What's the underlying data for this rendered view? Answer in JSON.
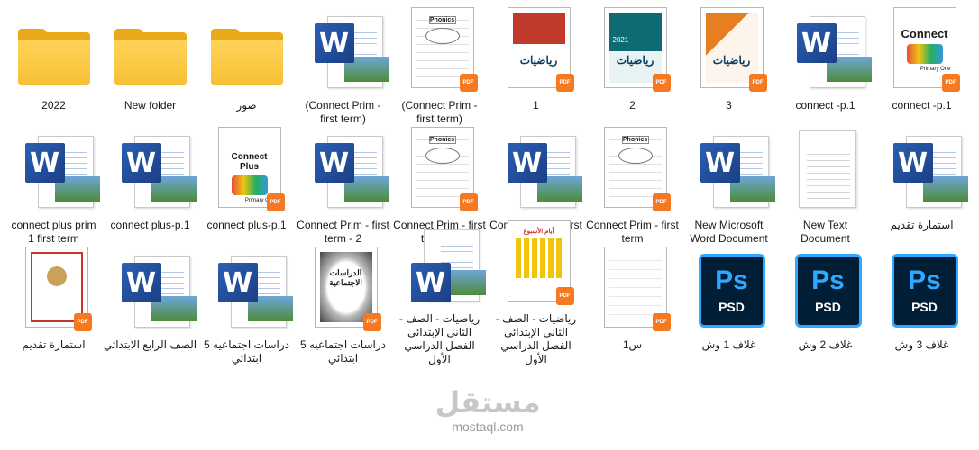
{
  "files": [
    {
      "name": "2022",
      "type": "folder",
      "rtl": false
    },
    {
      "name": "New folder",
      "type": "folder",
      "rtl": false
    },
    {
      "name": "صور",
      "type": "folder",
      "rtl": false
    },
    {
      "name": "(Connect Prim - first term)",
      "type": "word",
      "rtl": false
    },
    {
      "name": "(Connect Prim - first term)",
      "type": "pdf",
      "art": "worksheet",
      "rtl": false
    },
    {
      "name": "1",
      "type": "pdf",
      "art": "math-red",
      "rtl": false
    },
    {
      "name": "2",
      "type": "pdf",
      "art": "math-teal",
      "rtl": false
    },
    {
      "name": "3",
      "type": "pdf",
      "art": "math-orange",
      "rtl": false
    },
    {
      "name": "connect -p.1",
      "type": "word",
      "rtl": false
    },
    {
      "name": "connect -p.1",
      "type": "pdf",
      "art": "connect",
      "rtl": false
    },
    {
      "name": "connect plus prim 1 first term",
      "type": "word",
      "rtl": false
    },
    {
      "name": "connect plus-p.1",
      "type": "word",
      "rtl": false
    },
    {
      "name": "connect plus-p.1",
      "type": "pdf",
      "art": "connect-plus",
      "rtl": false
    },
    {
      "name": "Connect Prim - first term - 2",
      "type": "word",
      "rtl": false
    },
    {
      "name": "Connect Prim - first term - 2",
      "type": "pdf",
      "art": "phonics",
      "rtl": false
    },
    {
      "name": "Connect Prim - first term",
      "type": "word",
      "rtl": false
    },
    {
      "name": "Connect Prim - first term",
      "type": "pdf",
      "art": "worksheet",
      "rtl": false
    },
    {
      "name": "New Microsoft Word Document",
      "type": "word",
      "rtl": false
    },
    {
      "name": "New Text Document",
      "type": "text",
      "rtl": false
    },
    {
      "name": "استمارة تقديم",
      "type": "word",
      "rtl": true
    },
    {
      "name": "استمارة تقديم",
      "type": "pdf",
      "art": "form",
      "rtl": true
    },
    {
      "name": "الصف الرابع الابتدائي",
      "type": "word",
      "rtl": true
    },
    {
      "name": "دراسات اجتماعيه 5 ابتدائي",
      "type": "word",
      "rtl": true
    },
    {
      "name": "دراسات اجتماعيه 5 ابتدائي",
      "type": "pdf",
      "art": "social",
      "rtl": true
    },
    {
      "name": "رياضيات - الصف - الثاني الإبتدائي الفصل الدراسي الأول",
      "type": "word",
      "rtl": true
    },
    {
      "name": "رياضيات - الصف - الثاني الإبتدائي الفصل الدراسي الأول",
      "type": "pdf",
      "art": "days",
      "rtl": true
    },
    {
      "name": "س1",
      "type": "pdf",
      "art": "plain",
      "rtl": true
    },
    {
      "name": "غلاف 1 وش",
      "type": "psd",
      "rtl": true
    },
    {
      "name": "غلاف 2 وش",
      "type": "psd",
      "rtl": true
    },
    {
      "name": "غلاف 3 وش",
      "type": "psd",
      "rtl": true
    }
  ],
  "icons": {
    "word_letter": "W",
    "pdf_badge": "PDF",
    "psd_letters": "Ps",
    "psd_ext": "PSD"
  },
  "thumb_text": {
    "connect": "Connect",
    "connect_plus": "Connect Plus",
    "primary_one": "Primary One",
    "first_term": "First Term",
    "phonics": "Phonics",
    "math": "رياضيات",
    "social": "الدراسات الاجتماعية",
    "days": "أيام الأسبوع",
    "year": "2021"
  },
  "watermark": {
    "arabic": "مستقل",
    "latin": "mostaql.com"
  },
  "colors": {
    "folder": "#f6c035",
    "word": "#2b5fb3",
    "pdf_badge": "#f47920",
    "psd_bg": "#001e36",
    "psd_accent": "#31a8ff"
  }
}
